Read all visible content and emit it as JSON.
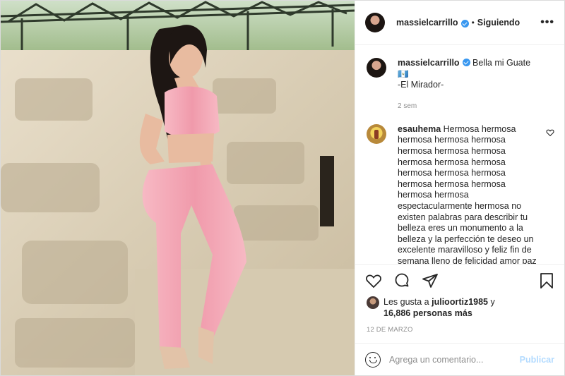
{
  "post": {
    "username": "massielcarrillo",
    "dot": "•",
    "follow_status": "Siguiendo",
    "more_label": "•••",
    "caption": {
      "text": "Bella mi Guate 🇬🇹",
      "line2": "-El Mirador-",
      "time_ago": "2 sem"
    },
    "comments": [
      {
        "username": "esauhema",
        "text": "Hermosa hermosa hermosa hermosa hermosa hermosa hermosa hermosa hermosa hermosa hermosa hermosa hermosa hermosa hermosa hermosa hermosa hermosa hermosa espectacularmente hermosa no existen palabras para describir tu belleza eres un monumento a la belleza y la perfección te deseo un excelente maravilloso y feliz fin de semana lleno de felicidad amor paz alegría luz éxito salud bienestar"
      }
    ],
    "likes": {
      "prefix": "Les gusta a",
      "liker": "julioortiz1985",
      "connector": "y",
      "count_text": "16,886 personas más"
    },
    "date": "12 DE MARZO",
    "add_comment": {
      "placeholder": "Agrega un comentario...",
      "publish_label": "Publicar"
    }
  },
  "colors": {
    "accent": "#3897f0",
    "publish_disabled": "#b3dbff",
    "muted": "#8e8e8e",
    "border": "#dbdbdb",
    "outfit_pink": "#f2a7b4"
  },
  "icons": [
    "more-icon",
    "heart-icon",
    "comment-icon",
    "share-icon",
    "bookmark-icon",
    "emoji-icon",
    "verified-icon"
  ]
}
